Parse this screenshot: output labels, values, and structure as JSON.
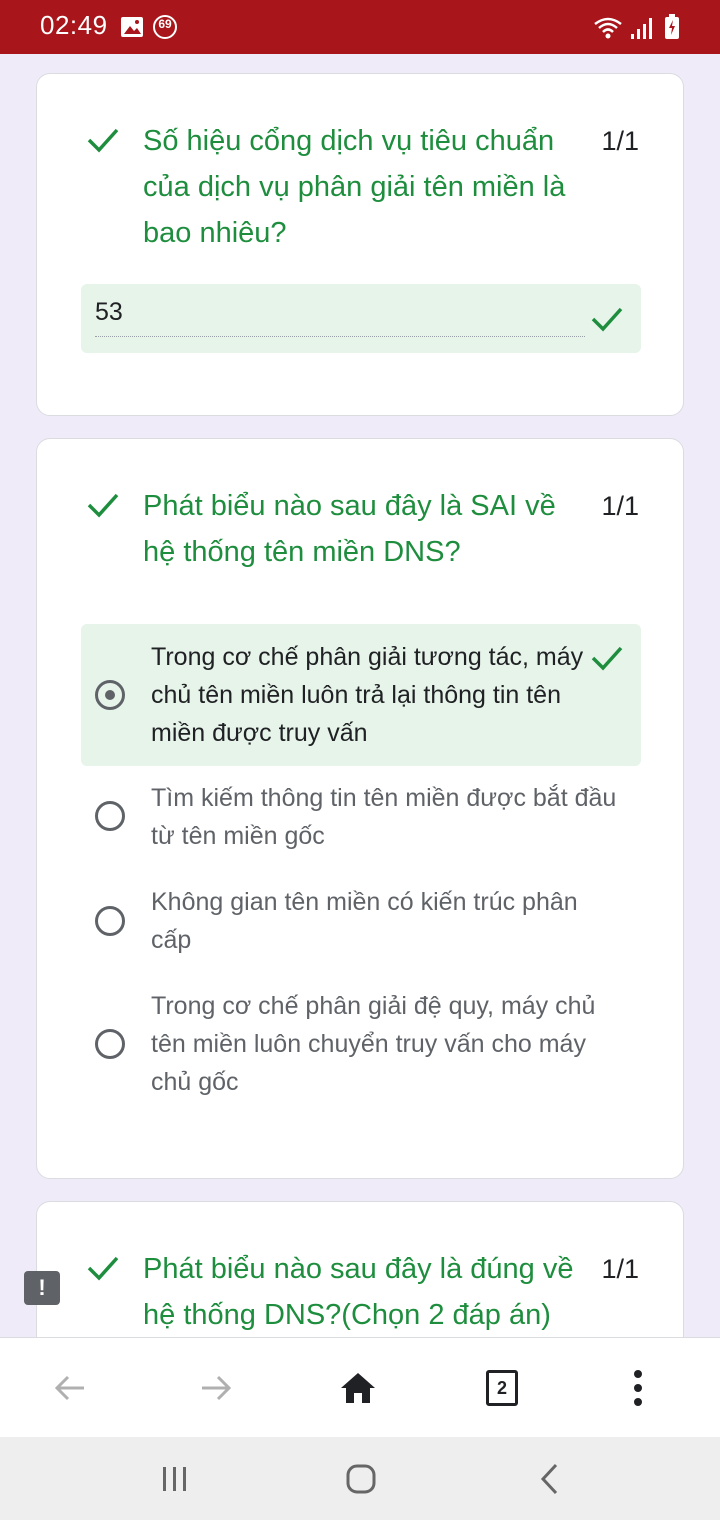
{
  "status_bar": {
    "time": "02:49",
    "notification_count": "69",
    "icons": [
      "image-icon",
      "notification-badge-icon",
      "wifi-icon",
      "signal-icon",
      "battery-icon"
    ]
  },
  "questions": [
    {
      "title": "Số hiệu cổng dịch vụ tiêu chuẩn của dịch vụ phân giải tên miền là bao nhiêu?",
      "score": "1/1",
      "answer_value": "53"
    },
    {
      "title": "Phát biểu nào sau đây là SAI về hệ thống tên miền DNS?",
      "score": "1/1",
      "options": [
        {
          "label": "Trong cơ chế phân giải tương tác, máy chủ tên miền luôn trả lại thông tin tên miền được truy vấn",
          "selected": true
        },
        {
          "label": "Tìm kiếm thông tin tên miền được bắt đầu từ tên miền gốc",
          "selected": false
        },
        {
          "label": "Không gian tên miền có kiến trúc phân cấp",
          "selected": false
        },
        {
          "label": "Trong cơ chế phân giải đệ quy, máy chủ tên miền luôn chuyển truy vấn cho máy chủ gốc",
          "selected": false
        }
      ]
    },
    {
      "title": "Phát biểu nào sau đây là đúng về hệ thống DNS?(Chọn 2 đáp án)",
      "score": "1/1"
    }
  ],
  "report_button": {
    "label": "!"
  },
  "browser_toolbar": {
    "tab_count": "2",
    "icons": [
      "back-arrow-icon",
      "forward-arrow-icon",
      "home-icon",
      "tabs-icon",
      "menu-icon"
    ]
  },
  "android_nav": {
    "icons": [
      "recent-apps-icon",
      "home-circle-icon",
      "back-chevron-icon"
    ]
  },
  "colors": {
    "status_bar": "#a8151b",
    "page_bg": "#f0ebf8",
    "correct_green": "#1e8e3e",
    "answer_bg": "#e6f4ea"
  }
}
